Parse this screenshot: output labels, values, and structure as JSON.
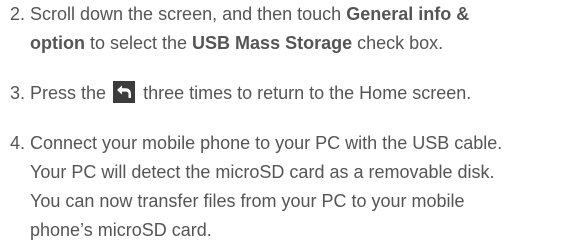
{
  "steps": [
    {
      "number": "2.",
      "line1_pre": "Scroll down the screen, and then touch ",
      "line1_bold": "General info &",
      "line2_bold_a": "option",
      "line2_mid": " to select the ",
      "line2_bold_b": "USB Mass Storage",
      "line2_post": " check box."
    },
    {
      "number": "3.",
      "pre": "Press the",
      "icon": "back-arrow-icon",
      "post": "three times to return to the Home screen."
    },
    {
      "number": "4.",
      "lines": [
        "Connect your mobile phone to your PC with the USB cable.",
        "Your PC will detect the microSD card as a removable disk.",
        "You can now transfer files from your PC to your mobile",
        "phone’s microSD card."
      ]
    }
  ]
}
